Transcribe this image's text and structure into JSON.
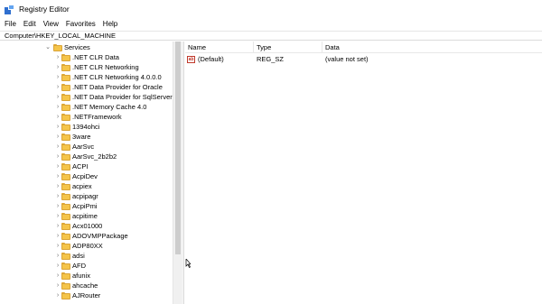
{
  "window": {
    "title": "Registry Editor",
    "icon": "registry-icon"
  },
  "menu": [
    "File",
    "Edit",
    "View",
    "Favorites",
    "Help"
  ],
  "address": "Computer\\HKEY_LOCAL_MACHINE",
  "tree": {
    "parent": "Services",
    "children": [
      ".NET CLR Data",
      ".NET CLR Networking",
      ".NET CLR Networking 4.0.0.0",
      ".NET Data Provider for Oracle",
      ".NET Data Provider for SqlServer",
      ".NET Memory Cache 4.0",
      ".NETFramework",
      "1394ohci",
      "3ware",
      "AarSvc",
      "AarSvc_2b2b2",
      "ACPI",
      "AcpiDev",
      "acpiex",
      "acpipagr",
      "AcpiPmi",
      "acpitime",
      "Acx01000",
      "ADOVMPPackage",
      "ADP80XX",
      "adsi",
      "AFD",
      "afunix",
      "ahcache",
      "AJRouter"
    ]
  },
  "list": {
    "columns": [
      "Name",
      "Type",
      "Data"
    ],
    "rows": [
      {
        "name": "(Default)",
        "type": "REG_SZ",
        "data": "(value not set)",
        "icon": "ab-string-icon"
      }
    ]
  }
}
